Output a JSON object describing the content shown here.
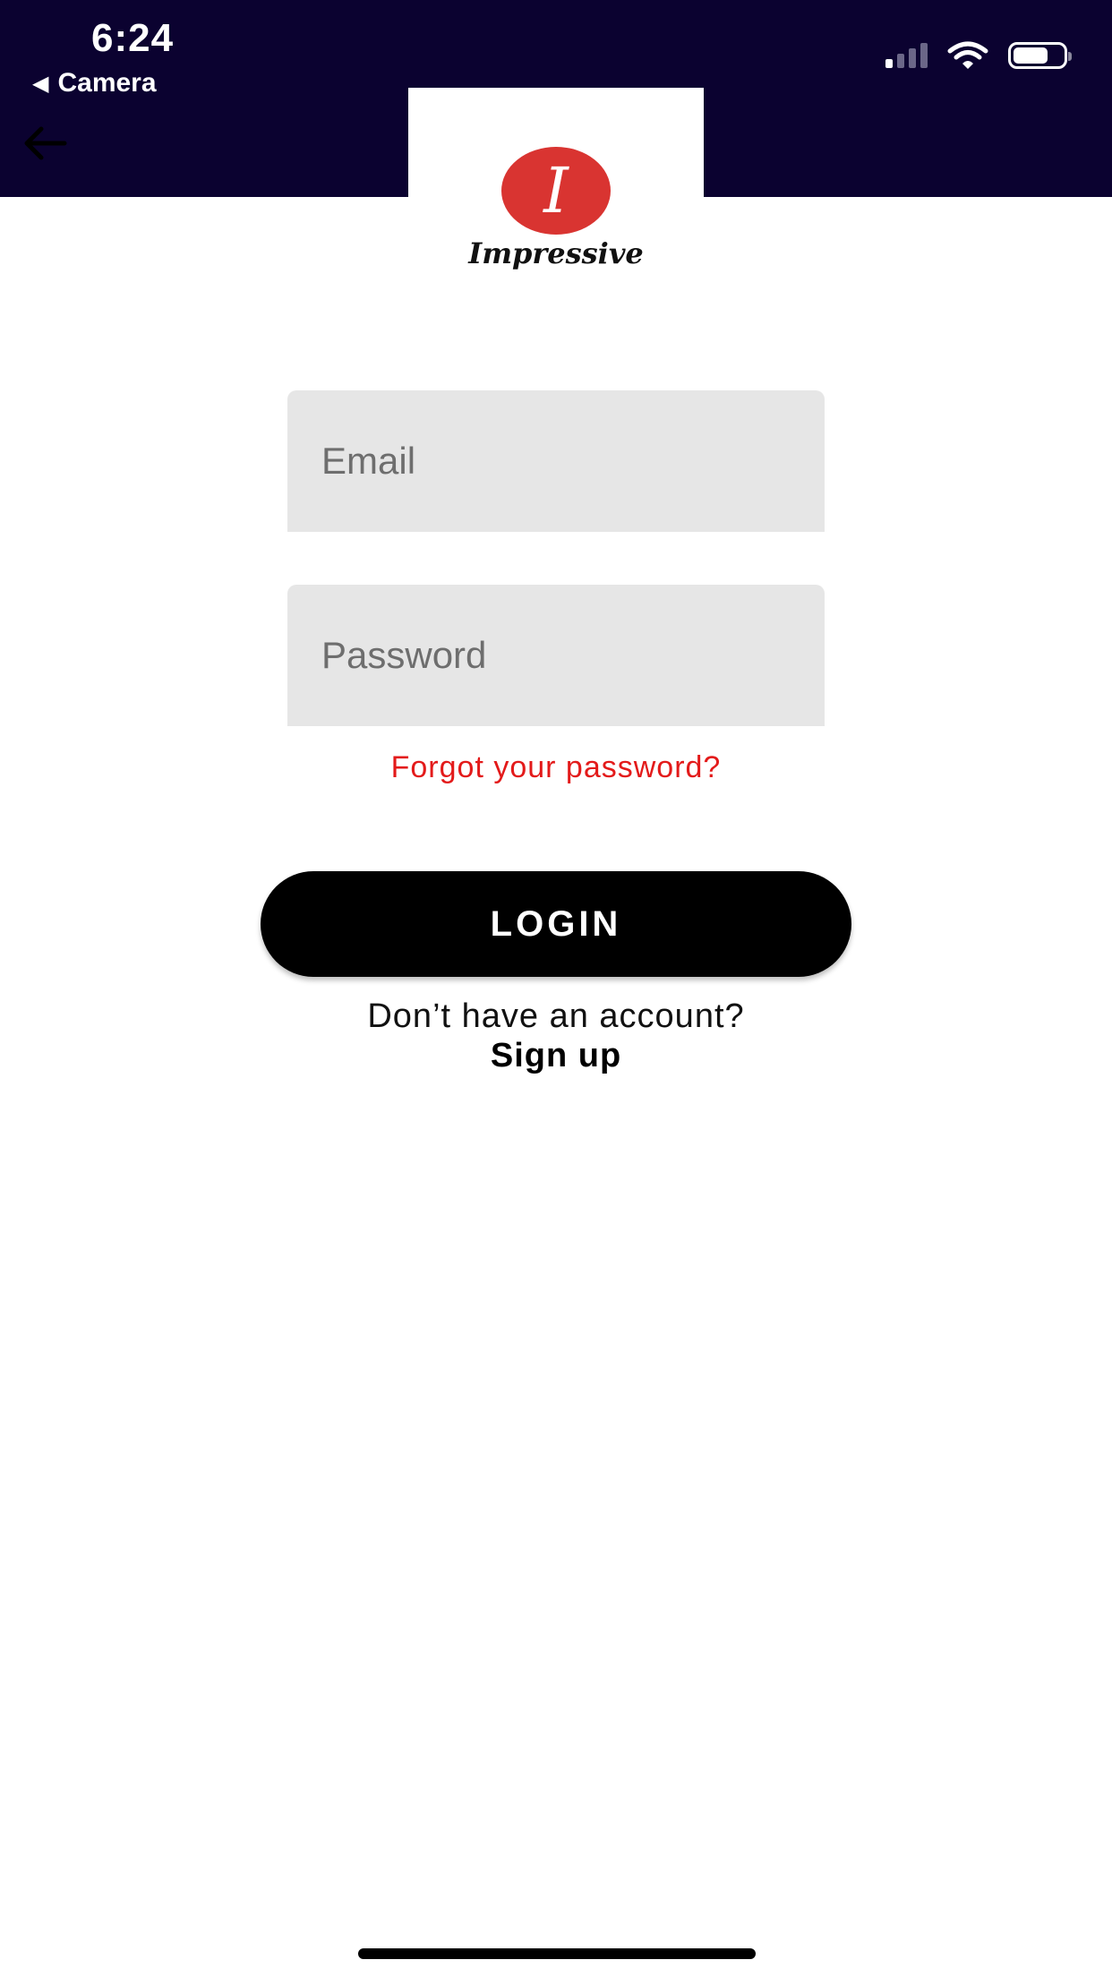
{
  "status_bar": {
    "time": "6:24",
    "back_app_label": "Camera",
    "back_app_icon": "left-triangle-icon",
    "signal_icon": "cellular-signal-icon",
    "wifi_icon": "wifi-icon",
    "battery_icon": "battery-icon",
    "battery_level": 0.7
  },
  "header": {
    "background_color": "#0b0230",
    "back_icon": "arrow-left-icon"
  },
  "logo": {
    "letter": "I",
    "name": "Impressive",
    "circle_color": "#d93431"
  },
  "form": {
    "email_placeholder": "Email",
    "email_value": "",
    "password_placeholder": "Password",
    "password_value": "",
    "forgot_label": "Forgot your password?",
    "forgot_color": "#e31a1a",
    "login_label": "LOGIN",
    "no_account_text": "Don’t have an account?",
    "signup_label": "Sign up"
  }
}
